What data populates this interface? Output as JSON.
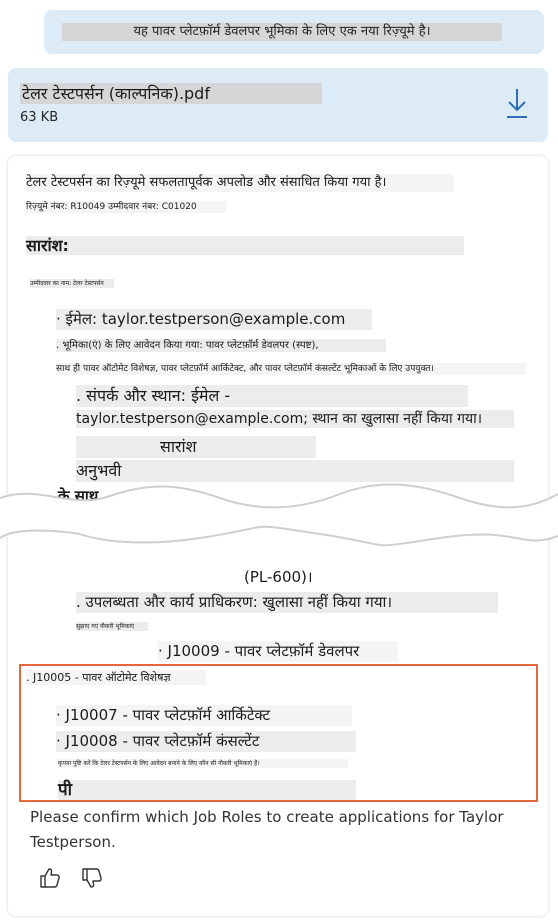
{
  "user_message": "यह पावर प्लेटफ़ॉर्म डेवलपर भूमिका के लिए एक नया रिज़्यूमे है।",
  "attachment": {
    "file_name": "टेलर टेस्टपर्सन (काल्पनिक).pdf",
    "file_size": "63 KB",
    "icon": "download-icon"
  },
  "response": {
    "upload_status": "टेलर टेस्टपर्सन का रिज़्यूमे सफलतापूर्वक अपलोड और संसाधित किया गया है।",
    "resume_ids": "रिज़्यूमे नंबर: R10049 उम्मीदवार नंबर: C01020",
    "summary_heading": "सारांश:",
    "tiny_note": "उम्मीदवार का नाम: टेलर टेस्टपर्सन",
    "email_line": "· ईमेल: taylor.testperson@example.com",
    "applied_roles_line": ". भूमिका(एं) के लिए आवेदन किया गया: पावर प्लेटफ़ॉर्म डेवलपर (स्पष्ट),",
    "suitable_line": "साथ ही पावर ऑटोमेट विशेषज्ञ, पावर प्लेटफ़ॉर्म आर्किटेक्ट, और पावर प्लेटफ़ॉर्म कंसल्टेंट भूमिकाओं के लिए उपयुक्त।",
    "contact_line1": ". संपर्क और स्थान: ईमेल -",
    "contact_line2": "taylor.testperson@example.com; स्थान का खुलासा नहीं किया गया।",
    "summary_sub": "सारांश",
    "experienced": "अनुभवी",
    "with_bullet": "के साथ",
    "cert_frag": "(PL-600)।",
    "availability_line": ". उपलब्धता और कार्य प्राधिकरण: खुलासा नहीं किया गया।",
    "matching_jobs_note": "सुझाए गए नौकरी भूमिकाएं",
    "job_1": "· J10009 - पावर प्लेटफ़ॉर्म डेवलपर",
    "job_2": ". J10005 - पावर ऑटोमेट विशेषज्ञ",
    "job_3": "· J10007 - पावर प्लेटफ़ॉर्म आर्किटेक्ट",
    "job_4": "· J10008 - पावर प्लेटफ़ॉर्म कंसल्टेंट",
    "confirm_note": "कृपया पुष्टि करें कि टेलर टेस्टपर्सन के लिए आवेदन बनाने के लिए कौन सी नौकरी भूमिकाएं हैं।",
    "pi_fragment": "पी",
    "confirm_english": "Please confirm which Job Roles to create applications for Taylor Testperson."
  },
  "feedback": {
    "like_icon": "thumbs-up-icon",
    "dislike_icon": "thumbs-down-icon"
  },
  "colors": {
    "bubble_bg": "#ddebf7",
    "highlight_border": "#e5683c",
    "icon_blue": "#2f6fb5"
  }
}
